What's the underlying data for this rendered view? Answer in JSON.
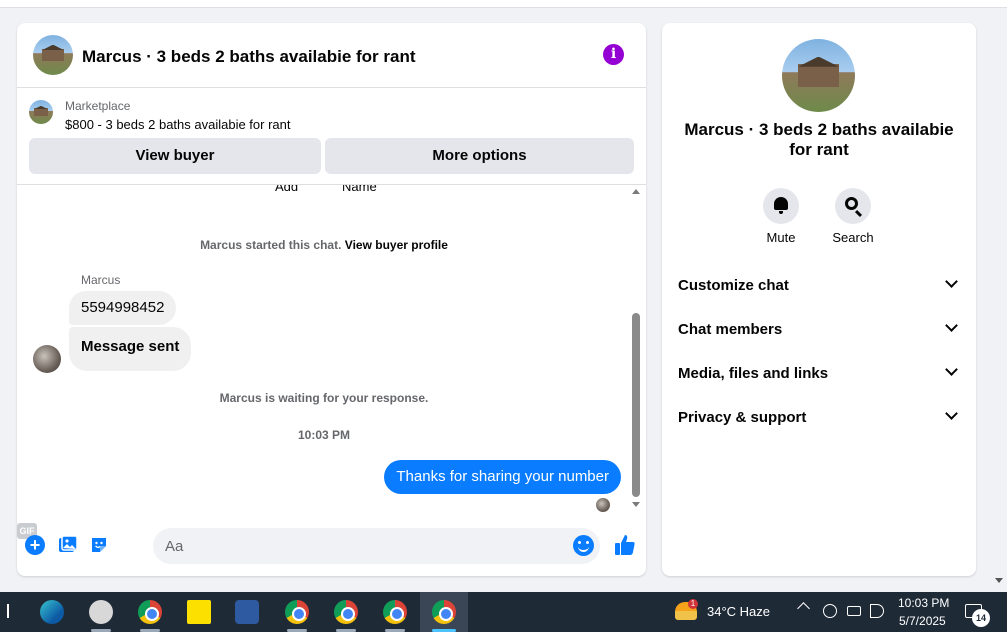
{
  "chat": {
    "title": "Marcus · 3 beds 2 baths availabie for rant",
    "marketplace_label": "Marketplace",
    "listing": "$800 - 3 beds 2 baths availabie for rant",
    "view_buyer_label": "View buyer",
    "more_options_label": "More options"
  },
  "messages": {
    "cutoff_left": "Add",
    "cutoff_right": "Name",
    "started_text": "Marcus started this chat. ",
    "view_profile_link": "View buyer profile",
    "sender_name": "Marcus",
    "incoming": [
      "5594998452",
      "Message sent"
    ],
    "waiting_text": "Marcus is waiting for your response.",
    "timestamp": "10:03 PM",
    "outgoing": "Thanks for sharing your number"
  },
  "composer": {
    "placeholder": "Aa",
    "gif_label": "GIF"
  },
  "info": {
    "title": "Marcus · 3 beds 2 baths availabie for rant",
    "mute_label": "Mute",
    "search_label": "Search",
    "sections": [
      "Customize chat",
      "Chat members",
      "Media, files and links",
      "Privacy & support"
    ]
  },
  "taskbar": {
    "weather_badge": "1",
    "weather_text": "34°C  Haze",
    "time": "10:03 PM",
    "date": "5/7/2025",
    "notification_count": "14"
  },
  "colors": {
    "accent_blue": "#0a7cff",
    "info_purple": "#9400d3",
    "taskbar": "#1f2a37"
  }
}
